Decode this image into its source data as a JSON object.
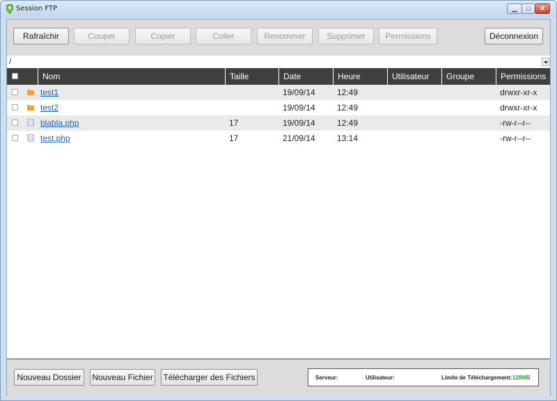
{
  "window": {
    "title": "Session FTP",
    "min_icon": "minimize-icon",
    "max_icon": "maximize-icon",
    "close_icon": "close-icon"
  },
  "toolbar": {
    "refresh": "Rafraîchir",
    "cut": "Couper",
    "copy": "Copier",
    "paste": "Coller",
    "rename": "Renommer",
    "delete": "Supprimer",
    "permissions": "Permissions",
    "logout": "Déconnexion"
  },
  "path": {
    "value": "/"
  },
  "table": {
    "headers": {
      "name": "Nom",
      "size": "Taille",
      "date": "Date",
      "time": "Heure",
      "user": "Utilisateur",
      "group": "Groupe",
      "perms": "Permissions"
    },
    "rows": [
      {
        "type": "folder",
        "name": "test1",
        "size": "",
        "date": "19/09/14",
        "time": "12:49",
        "user": "",
        "group": "",
        "perms": "drwxr-xr-x"
      },
      {
        "type": "folder",
        "name": "test2",
        "size": "",
        "date": "19/09/14",
        "time": "12:49",
        "user": "",
        "group": "",
        "perms": "drwxr-xr-x"
      },
      {
        "type": "file",
        "name": "blabla.php",
        "size": "17",
        "date": "19/09/14",
        "time": "12:49",
        "user": "",
        "group": "",
        "perms": "-rw-r--r--"
      },
      {
        "type": "file",
        "name": "test.php",
        "size": "17",
        "date": "21/09/14",
        "time": "13:14",
        "user": "",
        "group": "",
        "perms": "-rw-r--r--"
      }
    ]
  },
  "footer": {
    "new_folder": "Nouveau Dossier",
    "new_file": "Nouveau Fichier",
    "upload": "Télécharger des Fichiers",
    "server_label": "Serveur:",
    "user_label": "Utilisateur:",
    "limit_label": "Limite de Téléchargement:",
    "limit_value": "128MB"
  },
  "colors": {
    "header_bg": "#3f3f3f",
    "link": "#1d5fb2",
    "folder": "#f0a23a",
    "limit_value": "#2a9a2a"
  }
}
